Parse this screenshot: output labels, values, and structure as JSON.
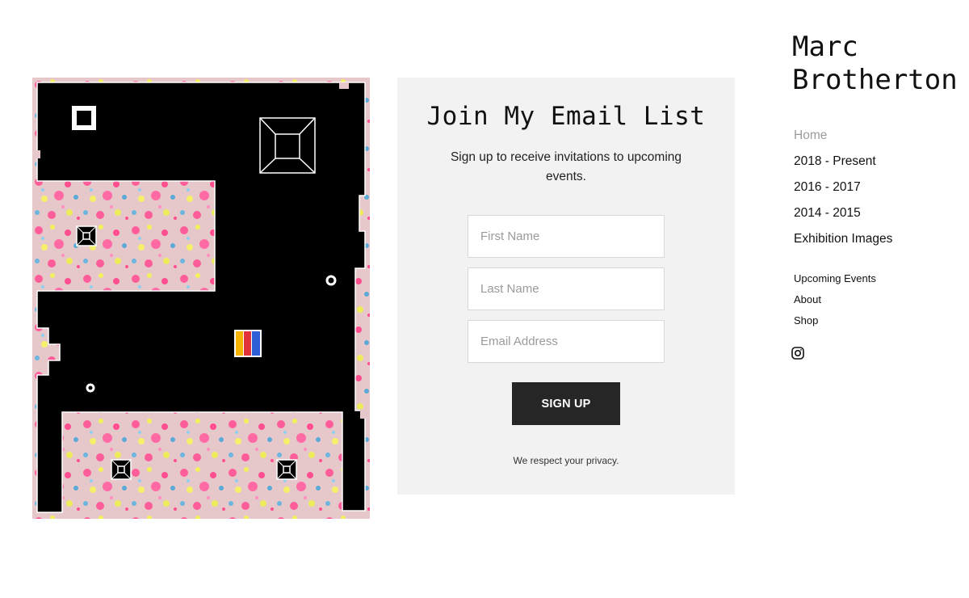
{
  "artwork": {
    "alt": "Abstract painting with black maze-like shapes over pink and yellow splatter"
  },
  "signup": {
    "title": "Join My Email List",
    "subtitle": "Sign up to receive invitations to upcoming events.",
    "first_name_placeholder": "First Name",
    "last_name_placeholder": "Last Name",
    "email_placeholder": "Email Address",
    "button_label": "SIGN UP",
    "privacy": "We respect your privacy."
  },
  "site": {
    "title": "Marc\nBrotherton"
  },
  "nav": {
    "items": [
      {
        "label": "Home",
        "active": true
      },
      {
        "label": "2018 - Present"
      },
      {
        "label": "2016 - 2017"
      },
      {
        "label": "2014 - 2015"
      },
      {
        "label": "Exhibition Images"
      }
    ],
    "secondary": [
      {
        "label": "Upcoming Events"
      },
      {
        "label": "About"
      },
      {
        "label": "Shop"
      }
    ],
    "social_icon": "instagram-icon"
  },
  "colors": {
    "panel_bg": "#f2f2f2",
    "button_bg": "#262626",
    "nav_active": "#9b9b9b"
  }
}
